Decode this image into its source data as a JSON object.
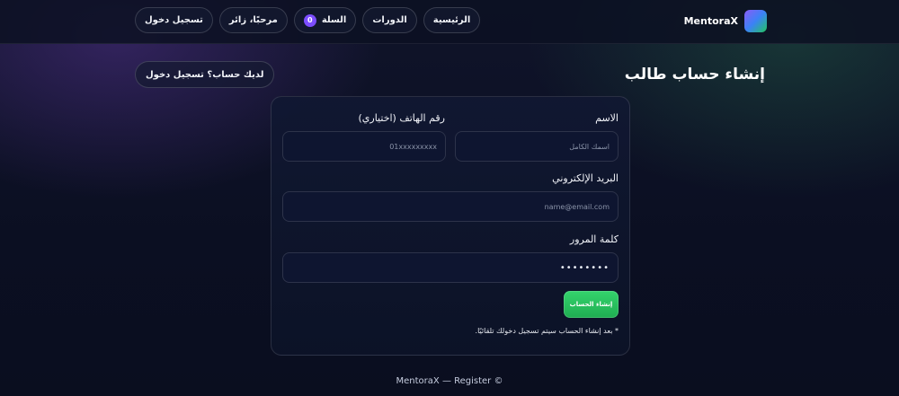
{
  "brand": {
    "name": "MentoraX"
  },
  "nav": {
    "home": "الرئيسية",
    "courses": "الدورات",
    "cart_label": "السلة",
    "cart_count": "0",
    "greeting": "مرحبًا، زائر",
    "login": "تسجيل دخول"
  },
  "page": {
    "title": "إنشاء حساب طالب",
    "have_account_link": "لديك حساب؟ تسجيل دخول"
  },
  "form": {
    "name_label": "الاسم",
    "name_placeholder": "اسمك الكامل",
    "phone_label": "رقم الهاتف (اختياري)",
    "phone_placeholder": "01xxxxxxxxx",
    "email_label": "البريد الإلكتروني",
    "email_placeholder": "name@email.com",
    "password_label": "كلمة المرور",
    "password_value": "••••••••",
    "submit_label": "إنشاء الحساب",
    "note": "* بعد إنشاء الحساب سيتم تسجيل دخولك تلقائيًا."
  },
  "footer": {
    "text": "© MentoraX — Register"
  },
  "colors": {
    "accent_green": "#22c55e",
    "badge_purple": "#7c4dff",
    "background": "#0b0f22"
  }
}
